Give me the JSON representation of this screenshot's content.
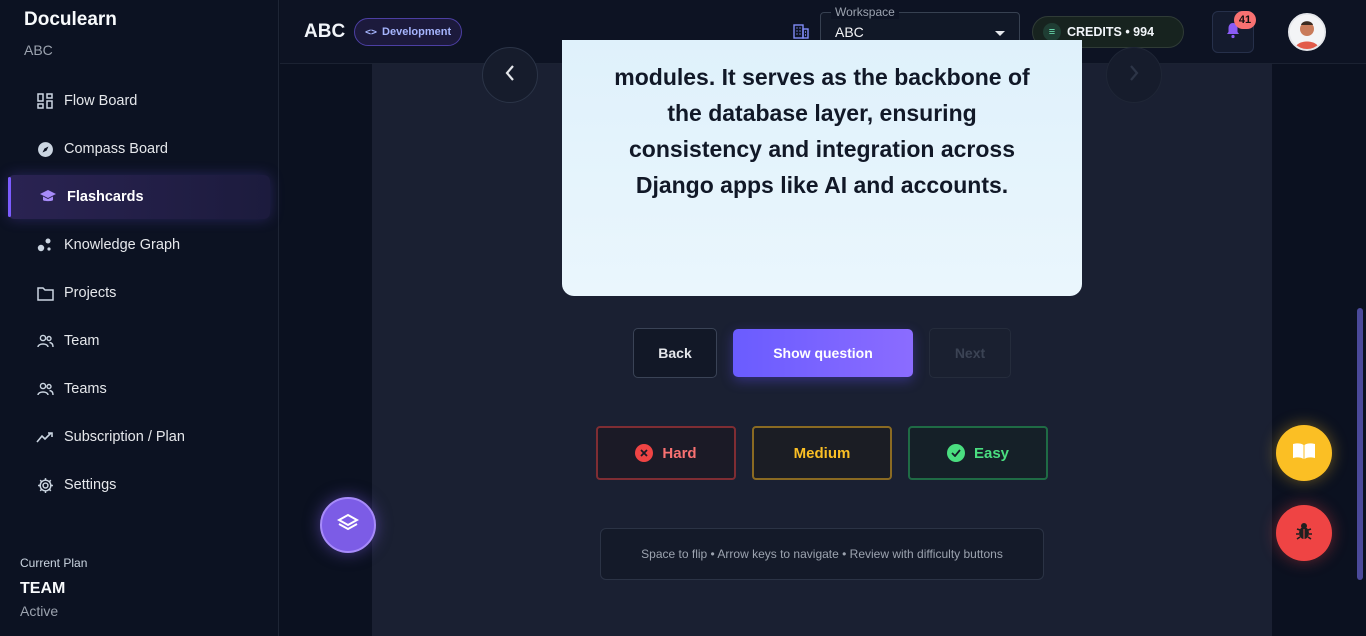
{
  "sidebar": {
    "brand": "Doculearn",
    "org": "ABC",
    "items": [
      {
        "label": "Flow Board",
        "icon": "dashboard-icon"
      },
      {
        "label": "Compass Board",
        "icon": "compass-icon"
      },
      {
        "label": "Flashcards",
        "icon": "graduation-cap-icon",
        "active": true
      },
      {
        "label": "Knowledge Graph",
        "icon": "graph-icon"
      },
      {
        "label": "Projects",
        "icon": "folder-icon"
      },
      {
        "label": "Team",
        "icon": "people-icon"
      },
      {
        "label": "Teams",
        "icon": "people-icon"
      },
      {
        "label": "Subscription / Plan",
        "icon": "trend-icon"
      },
      {
        "label": "Settings",
        "icon": "gear-icon"
      }
    ],
    "plan": {
      "label": "Current Plan",
      "name": "TEAM",
      "status": "Active"
    }
  },
  "header": {
    "project": "ABC",
    "badge": "Development",
    "workspace": {
      "label": "Workspace",
      "value": "ABC"
    },
    "credits": "CREDITS • 994",
    "notifications": "41"
  },
  "card": {
    "text": "modules. It serves as the backbone of the database layer, ensuring consistency and integration across Django apps like AI and accounts."
  },
  "controls": {
    "back": "Back",
    "show": "Show question",
    "next": "Next"
  },
  "difficulty": {
    "hard": "Hard",
    "medium": "Medium",
    "easy": "Easy"
  },
  "hint": "Space to flip • Arrow keys to navigate • Review with difficulty buttons",
  "colors": {
    "accent": "#7c5cff",
    "hard": "#f87171",
    "medium": "#fbbf24",
    "easy": "#4ade80"
  }
}
